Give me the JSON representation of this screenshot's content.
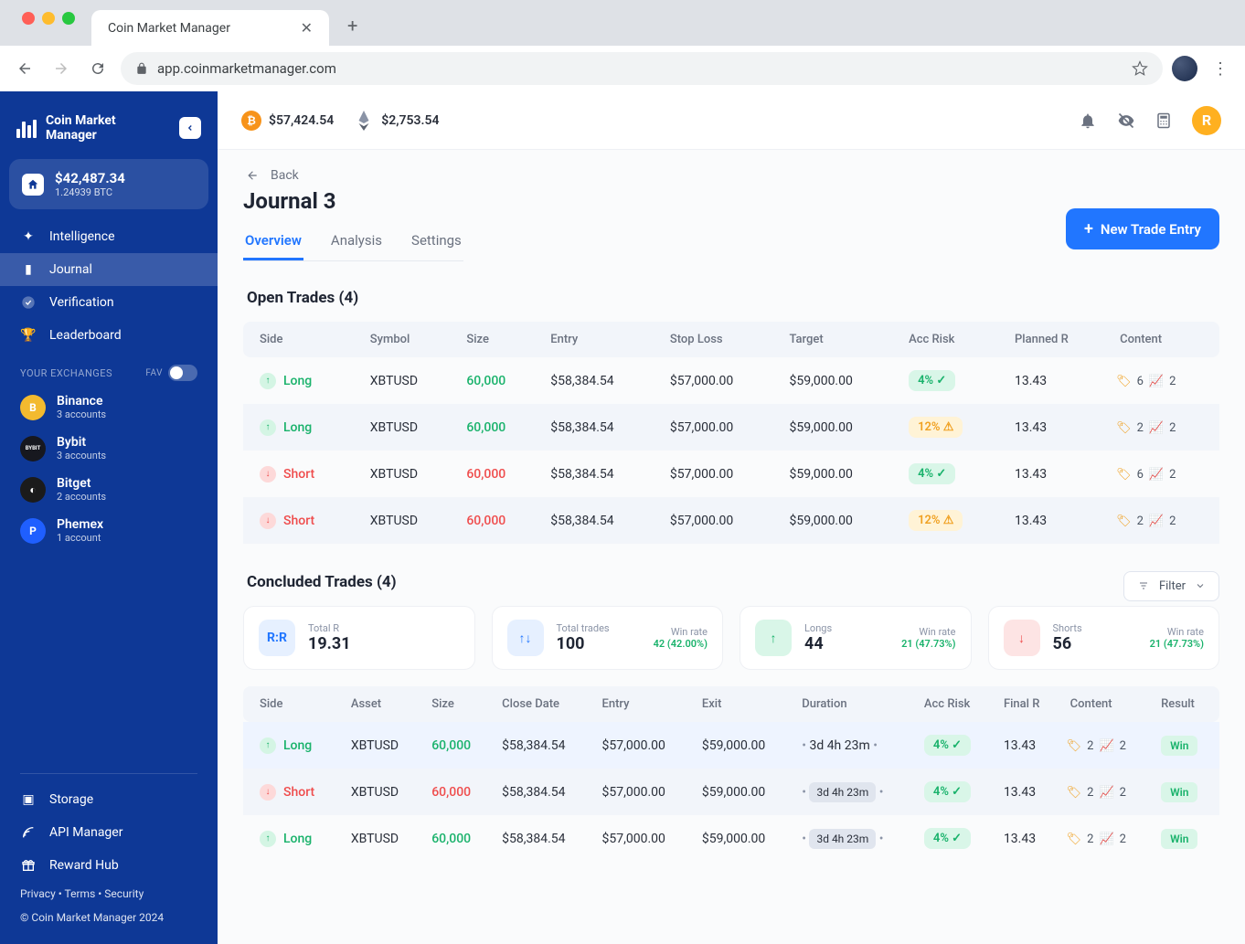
{
  "browser": {
    "tab_title": "Coin Market Manager",
    "url": "app.coinmarketmanager.com"
  },
  "app": {
    "logo": "Coin Market\nManager",
    "balance_usd": "$42,487.34",
    "balance_btc": "1.24939 BTC",
    "nav": {
      "intelligence": "Intelligence",
      "journal": "Journal",
      "verification": "Verification",
      "leaderboard": "Leaderboard"
    },
    "exchanges_label": "YOUR EXCHANGES",
    "fav_label": "FAV",
    "exchanges": [
      {
        "name": "Binance",
        "sub": "3 accounts",
        "bg": "#f3ba2f",
        "init": "B"
      },
      {
        "name": "Bybit",
        "sub": "3 accounts",
        "bg": "#17181f",
        "init": "BYBIT"
      },
      {
        "name": "Bitget",
        "sub": "2 accounts",
        "bg": "#1b1b1b",
        "init": "◐"
      },
      {
        "name": "Phemex",
        "sub": "1 account",
        "bg": "#1f5fff",
        "init": "P"
      }
    ],
    "bottom_nav": {
      "storage": "Storage",
      "api": "API Manager",
      "reward": "Reward Hub"
    },
    "footer_privacy": "Privacy",
    "footer_terms": "Terms",
    "footer_security": "Security",
    "copyright": "© Coin Market Manager 2024"
  },
  "topbar": {
    "btc_price": "$57,424.54",
    "eth_price": "$2,753.54",
    "user_initial": "R"
  },
  "page": {
    "back": "Back",
    "title": "Journal 3",
    "new_entry": "New Trade Entry",
    "tabs": {
      "overview": "Overview",
      "analysis": "Analysis",
      "settings": "Settings"
    }
  },
  "open_trades": {
    "title": "Open Trades (4)",
    "headers": {
      "side": "Side",
      "symbol": "Symbol",
      "size": "Size",
      "entry": "Entry",
      "stoploss": "Stop Loss",
      "target": "Target",
      "risk": "Acc Risk",
      "plannedr": "Planned R",
      "content": "Content"
    },
    "rows": [
      {
        "side": "Long",
        "symbol": "XBTUSD",
        "size": "60,000",
        "entry": "$58,384.54",
        "stoploss": "$57,000.00",
        "target": "$59,000.00",
        "risk": "4%",
        "risk_color": "green",
        "plannedr": "13.43",
        "tag_count": "6",
        "chart_count": "2"
      },
      {
        "side": "Long",
        "symbol": "XBTUSD",
        "size": "60,000",
        "entry": "$58,384.54",
        "stoploss": "$57,000.00",
        "target": "$59,000.00",
        "risk": "12%",
        "risk_color": "orange",
        "plannedr": "13.43",
        "tag_count": "2",
        "chart_count": "2"
      },
      {
        "side": "Short",
        "symbol": "XBTUSD",
        "size": "60,000",
        "entry": "$58,384.54",
        "stoploss": "$57,000.00",
        "target": "$59,000.00",
        "risk": "4%",
        "risk_color": "green",
        "plannedr": "13.43",
        "tag_count": "6",
        "chart_count": "2"
      },
      {
        "side": "Short",
        "symbol": "XBTUSD",
        "size": "60,000",
        "entry": "$58,384.54",
        "stoploss": "$57,000.00",
        "target": "$59,000.00",
        "risk": "12%",
        "risk_color": "orange",
        "plannedr": "13.43",
        "tag_count": "2",
        "chart_count": "2"
      }
    ]
  },
  "concluded": {
    "title": "Concluded Trades (4)",
    "filter": "Filter",
    "stats": {
      "total_r_label": "Total R",
      "total_r_value": "19.31",
      "total_trades_label": "Total trades",
      "total_trades_value": "100",
      "total_trades_wr_label": "Win rate",
      "total_trades_wr": "42 (42.00%)",
      "longs_label": "Longs",
      "longs_value": "44",
      "longs_wr_label": "Win rate",
      "longs_wr": "21 (47.73%)",
      "shorts_label": "Shorts",
      "shorts_value": "56",
      "shorts_wr_label": "Win rate",
      "shorts_wr": "21 (47.73%)"
    },
    "headers": {
      "side": "Side",
      "asset": "Asset",
      "size": "Size",
      "closedate": "Close Date",
      "entry": "Entry",
      "exit": "Exit",
      "duration": "Duration",
      "risk": "Acc Risk",
      "finalr": "Final R",
      "content": "Content",
      "result": "Result"
    },
    "rows": [
      {
        "side": "Long",
        "asset": "XBTUSD",
        "size": "60,000",
        "closedate": "$58,384.54",
        "entry": "$57,000.00",
        "exit": "$59,000.00",
        "duration": "3d 4h 23m",
        "risk": "4%",
        "finalr": "13.43",
        "tag_count": "2",
        "chart_count": "2",
        "result": "Win"
      },
      {
        "side": "Short",
        "asset": "XBTUSD",
        "size": "60,000",
        "closedate": "$58,384.54",
        "entry": "$57,000.00",
        "exit": "$59,000.00",
        "duration": "3d 4h 23m",
        "risk": "4%",
        "finalr": "13.43",
        "tag_count": "2",
        "chart_count": "2",
        "result": "Win"
      },
      {
        "side": "Long",
        "asset": "XBTUSD",
        "size": "60,000",
        "closedate": "$58,384.54",
        "entry": "$57,000.00",
        "exit": "$59,000.00",
        "duration": "3d 4h 23m",
        "risk": "4%",
        "finalr": "13.43",
        "tag_count": "2",
        "chart_count": "2",
        "result": "Win"
      }
    ]
  }
}
